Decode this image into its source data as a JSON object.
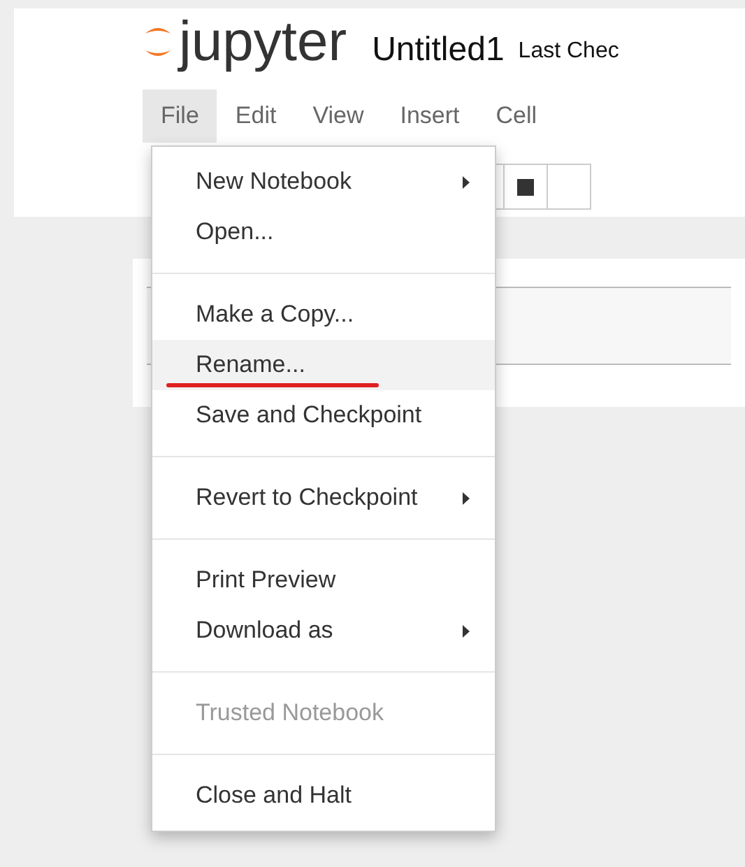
{
  "header": {
    "logo_text": "jupyter",
    "notebook_title": "Untitled1",
    "checkpoint_status": "Last Chec"
  },
  "menubar": [
    {
      "label": "File",
      "selected": true
    },
    {
      "label": "Edit",
      "selected": false
    },
    {
      "label": "View",
      "selected": false
    },
    {
      "label": "Insert",
      "selected": false
    },
    {
      "label": "Cell",
      "selected": false
    }
  ],
  "file_menu": {
    "groups": [
      [
        {
          "label": "New Notebook",
          "submenu": true,
          "disabled": false,
          "selected": false,
          "underlined": false
        },
        {
          "label": "Open...",
          "submenu": false,
          "disabled": false,
          "selected": false,
          "underlined": false
        }
      ],
      [
        {
          "label": "Make a Copy...",
          "submenu": false,
          "disabled": false,
          "selected": false,
          "underlined": false
        },
        {
          "label": "Rename...",
          "submenu": false,
          "disabled": false,
          "selected": true,
          "underlined": true
        },
        {
          "label": "Save and Checkpoint",
          "submenu": false,
          "disabled": false,
          "selected": false,
          "underlined": false
        }
      ],
      [
        {
          "label": "Revert to Checkpoint",
          "submenu": true,
          "disabled": false,
          "selected": false,
          "underlined": false
        }
      ],
      [
        {
          "label": "Print Preview",
          "submenu": false,
          "disabled": false,
          "selected": false,
          "underlined": false
        },
        {
          "label": "Download as",
          "submenu": true,
          "disabled": false,
          "selected": false,
          "underlined": false
        }
      ],
      [
        {
          "label": "Trusted Notebook",
          "submenu": false,
          "disabled": true,
          "selected": false,
          "underlined": false
        }
      ],
      [
        {
          "label": "Close and Halt",
          "submenu": false,
          "disabled": false,
          "selected": false,
          "underlined": false
        }
      ]
    ]
  }
}
